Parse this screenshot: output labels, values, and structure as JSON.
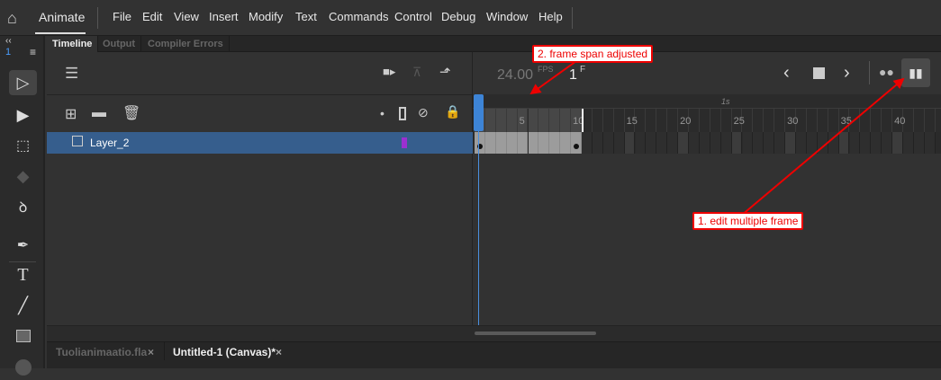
{
  "app": {
    "name": "Animate"
  },
  "menu": [
    "File",
    "Edit",
    "View",
    "Insert",
    "Modify",
    "Text",
    "Commands",
    "Control",
    "Debug",
    "Window",
    "Help"
  ],
  "panel_tabs": [
    "Timeline",
    "Output",
    "Compiler Errors"
  ],
  "tools_header": {
    "number": "1"
  },
  "timeline": {
    "fps": "24.00",
    "fps_unit": "FPS",
    "frame": "1",
    "frame_unit": "F",
    "second_marker": "1s",
    "ruler_labels": [
      "5",
      "10",
      "15",
      "20",
      "25",
      "30",
      "35",
      "40"
    ],
    "span_start": 1,
    "span_end": 10
  },
  "layers": [
    {
      "name": "Layer_2",
      "color": "#9b30d0"
    }
  ],
  "doc_tabs": [
    {
      "label": "Tuolianimaatio.fla",
      "active": false
    },
    {
      "label": "Untitled-1 (Canvas)*",
      "active": true
    }
  ],
  "annotations": {
    "note1": "1. edit multiple frame",
    "note2": "2. frame span adjusted",
    "color": "#e00000"
  }
}
